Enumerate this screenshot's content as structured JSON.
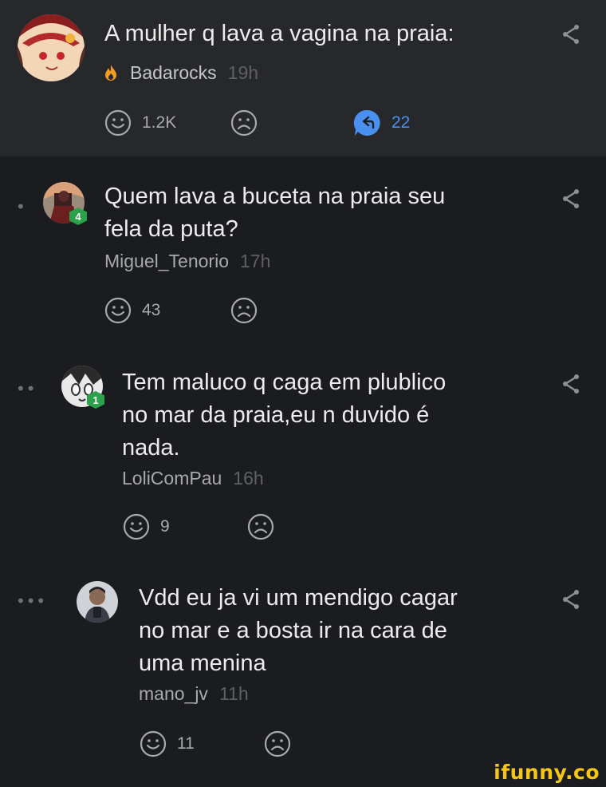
{
  "post": {
    "title": "A mulher q lava a vagina na praia:",
    "author": "Badarocks",
    "time": "19h",
    "smile_count": "1.2K",
    "replies_count": "22"
  },
  "comments": [
    {
      "lines": [
        "Quem lava a buceta na praia seu",
        "fela da puta?"
      ],
      "author": "Miguel_Tenorio",
      "time": "17h",
      "level": "4",
      "smile_count": "43"
    },
    {
      "lines": [
        "Tem maluco q caga em plublico",
        "no mar da praia,eu n duvido é",
        "nada."
      ],
      "author": "LoliComPau",
      "time": "16h",
      "level": "1",
      "smile_count": "9"
    },
    {
      "lines": [
        "Vdd eu ja vi um mendigo cagar",
        "no mar e a bosta ir na cara de",
        "uma menina"
      ],
      "author": "mano_jv",
      "time": "11h",
      "smile_count": "11"
    }
  ],
  "watermark": "ifunny.co",
  "icons": {
    "share": "share-icon",
    "smile": "smile-icon",
    "unsmile": "unsmile-icon",
    "reply": "reply-icon",
    "flame": "flame-icon"
  },
  "colors": {
    "background": "#1b1c20",
    "post_background": "#27282c",
    "reply_accent": "#4a90f0",
    "level_badge": "#2aa24a",
    "watermark": "#f5c518"
  }
}
